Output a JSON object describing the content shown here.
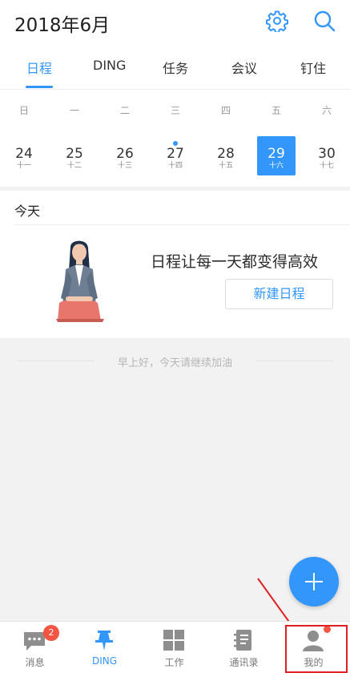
{
  "header": {
    "title": "2018年6月",
    "icons": [
      "gear-icon",
      "search-icon"
    ]
  },
  "tabs": [
    {
      "label": "日程",
      "active": true
    },
    {
      "label": "DING",
      "active": false
    },
    {
      "label": "任务",
      "active": false
    },
    {
      "label": "会议",
      "active": false
    },
    {
      "label": "钉住",
      "active": false
    }
  ],
  "week": {
    "weekdays": [
      "日",
      "一",
      "二",
      "三",
      "四",
      "五",
      "六"
    ],
    "days": [
      {
        "num": "24",
        "lunar": "十一",
        "selected": false,
        "has_event": false
      },
      {
        "num": "25",
        "lunar": "十二",
        "selected": false,
        "has_event": false
      },
      {
        "num": "26",
        "lunar": "十三",
        "selected": false,
        "has_event": false
      },
      {
        "num": "27",
        "lunar": "十四",
        "selected": false,
        "has_event": true
      },
      {
        "num": "28",
        "lunar": "十五",
        "selected": false,
        "has_event": false
      },
      {
        "num": "29",
        "lunar": "十六",
        "selected": true,
        "has_event": false
      },
      {
        "num": "30",
        "lunar": "十七",
        "selected": false,
        "has_event": false
      }
    ]
  },
  "today": {
    "label": "今天",
    "empty_message": "日程让每一天都变得高效",
    "new_button": "新建日程"
  },
  "greeting": "早上好，今天请继续加油",
  "fab_icon": "plus-icon",
  "bottom_nav": [
    {
      "label": "消息",
      "icon": "chat-icon",
      "badge": "2",
      "active": false
    },
    {
      "label": "DING",
      "icon": "pin-icon",
      "active": true
    },
    {
      "label": "工作",
      "icon": "grid-icon",
      "active": false
    },
    {
      "label": "通讯录",
      "icon": "contacts-book-icon",
      "active": false
    },
    {
      "label": "我的",
      "icon": "person-icon",
      "red_dot": true,
      "active": false
    }
  ],
  "colors": {
    "accent": "#3296fa",
    "badge": "#f25643",
    "annotation": "#e02020"
  }
}
